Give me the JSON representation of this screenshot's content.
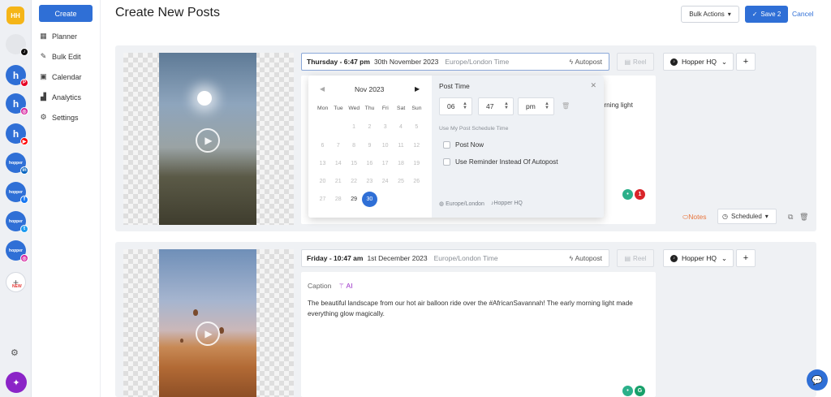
{
  "rail": {
    "logo": "HH",
    "accounts": [
      {
        "name": "user-tiktok",
        "letter": "",
        "net": "♪",
        "net_color": "#111111"
      },
      {
        "name": "hopper-pinterest",
        "letter": "h",
        "net": "P",
        "net_color": "#e60023"
      },
      {
        "name": "hopper-instagram",
        "letter": "h",
        "net": "◎",
        "net_color": "#d6249f"
      },
      {
        "name": "hopper-youtube",
        "letter": "h",
        "net": "▶",
        "net_color": "#ff0000"
      },
      {
        "name": "hopper-linkedin",
        "letter": "hopper",
        "net": "in",
        "net_color": "#0a66c2"
      },
      {
        "name": "hopper-facebook",
        "letter": "hopper",
        "net": "f",
        "net_color": "#1877f2"
      },
      {
        "name": "hopper-twitter",
        "letter": "hopper",
        "net": "t",
        "net_color": "#1d9bf0"
      },
      {
        "name": "hopper-instagram-2",
        "letter": "hopper",
        "net": "◎",
        "net_color": "#d6249f"
      }
    ],
    "new_tag": "NEW"
  },
  "nav": {
    "create": "Create",
    "items": [
      {
        "label": "Planner",
        "icon": "grid-icon"
      },
      {
        "label": "Bulk Edit",
        "icon": "edit-icon"
      },
      {
        "label": "Calendar",
        "icon": "calendar-icon"
      },
      {
        "label": "Analytics",
        "icon": "analytics-icon"
      },
      {
        "label": "Settings",
        "icon": "gear-icon"
      }
    ]
  },
  "header": {
    "title": "Create New Posts",
    "bulk_actions": "Bulk Actions",
    "save": "Save 2",
    "cancel": "Cancel"
  },
  "posts": [
    {
      "day": "Thursday - 6:47 pm",
      "date": "30th November 2023",
      "timezone": "Europe/London Time",
      "autopost": "Autopost",
      "reel": "Reel",
      "account": "Hopper HQ",
      "caption_partial": "morning light",
      "notes": "Notes",
      "status": "Scheduled",
      "alert_count": "1"
    },
    {
      "day": "Friday - 10:47 am",
      "date": "1st December 2023",
      "timezone": "Europe/London Time",
      "autopost": "Autopost",
      "reel": "Reel",
      "account": "Hopper HQ",
      "caption_label": "Caption",
      "ai": "AI",
      "caption": "The beautiful landscape from our hot air balloon ride over the #AfricanSavannah! The early morning light made everything glow magically.",
      "grammar": "G"
    }
  ],
  "picker": {
    "month": "Nov 2023",
    "weekdays": [
      "Mon",
      "Tue",
      "Wed",
      "Thu",
      "Fri",
      "Sat",
      "Sun"
    ],
    "weeks": [
      [
        "",
        "",
        "1",
        "2",
        "3",
        "4",
        "5"
      ],
      [
        "6",
        "7",
        "8",
        "9",
        "10",
        "11",
        "12"
      ],
      [
        "13",
        "14",
        "15",
        "16",
        "17",
        "18",
        "19"
      ],
      [
        "20",
        "21",
        "22",
        "23",
        "24",
        "25",
        "26"
      ],
      [
        "27",
        "28",
        "29",
        "30",
        "",
        "",
        ""
      ]
    ],
    "enabled_days": [
      "29",
      "30"
    ],
    "selected_day": "30",
    "post_time_title": "Post Time",
    "hour": "06",
    "minute": "47",
    "ampm": "pm",
    "schedule_hint": "Use My Post Schedule Time",
    "post_now": "Post Now",
    "reminder": "Use Reminder Instead Of Autopost",
    "footer_tz": "Europe/London",
    "footer_account": "Hopper HQ"
  },
  "colors": {
    "primary": "#2f6fd6",
    "accent_purple": "#9b30c8",
    "notes_orange": "#e8743b",
    "alert_red": "#d9252a"
  }
}
